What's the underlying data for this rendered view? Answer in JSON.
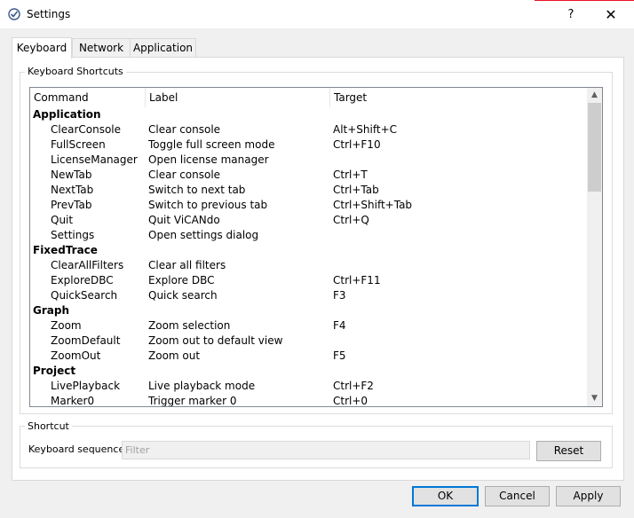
{
  "window": {
    "title": "Settings",
    "help_glyph": "?",
    "close_glyph": "✕"
  },
  "tabs": [
    {
      "label": "Keyboard"
    },
    {
      "label": "Network"
    },
    {
      "label": "Application"
    }
  ],
  "keyboard_shortcuts": {
    "group_label": "Keyboard Shortcuts",
    "columns": [
      "Command",
      "Label",
      "Target"
    ],
    "rows": [
      {
        "command": "Application",
        "label": "",
        "target": ""
      },
      {
        "command": "ClearConsole",
        "label": "Clear console",
        "target": "Alt+Shift+C"
      },
      {
        "command": "FullScreen",
        "label": "Toggle full screen mode",
        "target": "Ctrl+F10"
      },
      {
        "command": "LicenseManager",
        "label": "Open license manager",
        "target": ""
      },
      {
        "command": "NewTab",
        "label": "Clear console",
        "target": "Ctrl+T"
      },
      {
        "command": "NextTab",
        "label": "Switch to next tab",
        "target": "Ctrl+Tab"
      },
      {
        "command": "PrevTab",
        "label": "Switch to previous tab",
        "target": "Ctrl+Shift+Tab"
      },
      {
        "command": "Quit",
        "label": "Quit ViCANdo",
        "target": "Ctrl+Q"
      },
      {
        "command": "Settings",
        "label": "Open settings dialog",
        "target": ""
      },
      {
        "command": "FixedTrace",
        "label": "",
        "target": ""
      },
      {
        "command": "ClearAllFilters",
        "label": "Clear all filters",
        "target": ""
      },
      {
        "command": "ExploreDBC",
        "label": "Explore DBC",
        "target": "Ctrl+F11"
      },
      {
        "command": "QuickSearch",
        "label": "Quick search",
        "target": "F3"
      },
      {
        "command": "Graph",
        "label": "",
        "target": ""
      },
      {
        "command": "Zoom",
        "label": "Zoom selection",
        "target": "F4"
      },
      {
        "command": "ZoomDefault",
        "label": "Zoom out to default view",
        "target": ""
      },
      {
        "command": "ZoomOut",
        "label": "Zoom out",
        "target": "F5"
      },
      {
        "command": "Project",
        "label": "",
        "target": ""
      },
      {
        "command": "LivePlayback",
        "label": "Live playback mode",
        "target": "Ctrl+F2"
      },
      {
        "command": "Marker0",
        "label": "Trigger marker 0",
        "target": "Ctrl+0"
      }
    ]
  },
  "shortcut": {
    "group_label": "Shortcut",
    "sequence_label": "Keyboard sequence:",
    "filter_placeholder": "Filter",
    "filter_value": "",
    "reset_label": "Reset"
  },
  "buttons": {
    "ok": "OK",
    "cancel": "Cancel",
    "apply": "Apply"
  },
  "colors": {
    "accent": "#0078d7",
    "close_hover_line": "#e81123"
  }
}
